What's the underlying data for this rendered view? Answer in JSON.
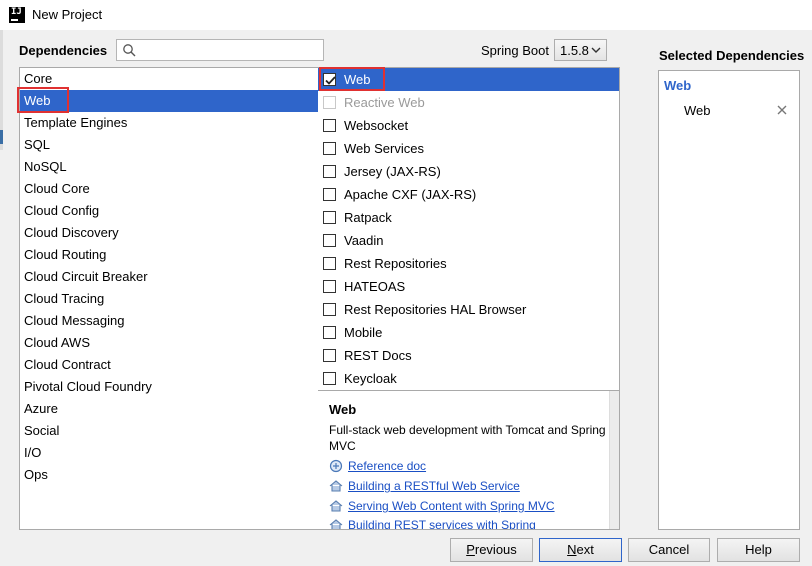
{
  "window": {
    "title": "New Project"
  },
  "header": {
    "dependencies_label": "Dependencies",
    "search_value": "",
    "spring_boot_label": "Spring Boot",
    "spring_boot_version": "1.5.8"
  },
  "categories": [
    "Core",
    "Web",
    "Template Engines",
    "SQL",
    "NoSQL",
    "Cloud Core",
    "Cloud Config",
    "Cloud Discovery",
    "Cloud Routing",
    "Cloud Circuit Breaker",
    "Cloud Tracing",
    "Cloud Messaging",
    "Cloud AWS",
    "Cloud Contract",
    "Pivotal Cloud Foundry",
    "Azure",
    "Social",
    "I/O",
    "Ops"
  ],
  "selected_category": "Web",
  "dependencies": [
    {
      "label": "Web",
      "checked": true,
      "enabled": true
    },
    {
      "label": "Reactive Web",
      "checked": false,
      "enabled": false
    },
    {
      "label": "Websocket",
      "checked": false,
      "enabled": true
    },
    {
      "label": "Web Services",
      "checked": false,
      "enabled": true
    },
    {
      "label": "Jersey (JAX-RS)",
      "checked": false,
      "enabled": true
    },
    {
      "label": "Apache CXF (JAX-RS)",
      "checked": false,
      "enabled": true
    },
    {
      "label": "Ratpack",
      "checked": false,
      "enabled": true
    },
    {
      "label": "Vaadin",
      "checked": false,
      "enabled": true
    },
    {
      "label": "Rest Repositories",
      "checked": false,
      "enabled": true
    },
    {
      "label": "HATEOAS",
      "checked": false,
      "enabled": true
    },
    {
      "label": "Rest Repositories HAL Browser",
      "checked": false,
      "enabled": true
    },
    {
      "label": "Mobile",
      "checked": false,
      "enabled": true
    },
    {
      "label": "REST Docs",
      "checked": false,
      "enabled": true
    },
    {
      "label": "Keycloak",
      "checked": false,
      "enabled": true
    }
  ],
  "description": {
    "title": "Web",
    "text": "Full-stack web development with Tomcat and Spring MVC",
    "links": [
      {
        "label": "Reference doc",
        "icon": "reference-doc-icon"
      },
      {
        "label": "Building a RESTful Web Service",
        "icon": "home-icon"
      },
      {
        "label": "Serving Web Content with Spring MVC",
        "icon": "home-icon"
      },
      {
        "label": "Building REST services with Spring",
        "icon": "home-icon"
      }
    ]
  },
  "selected_dependencies": {
    "label": "Selected Dependencies",
    "group": "Web",
    "items": [
      "Web"
    ]
  },
  "buttons": {
    "previous": "Previous",
    "next": "Next",
    "cancel": "Cancel",
    "help": "Help"
  },
  "colors": {
    "selection": "#2f65ca",
    "highlight_box": "#e03131",
    "link": "#1a4fc4"
  }
}
